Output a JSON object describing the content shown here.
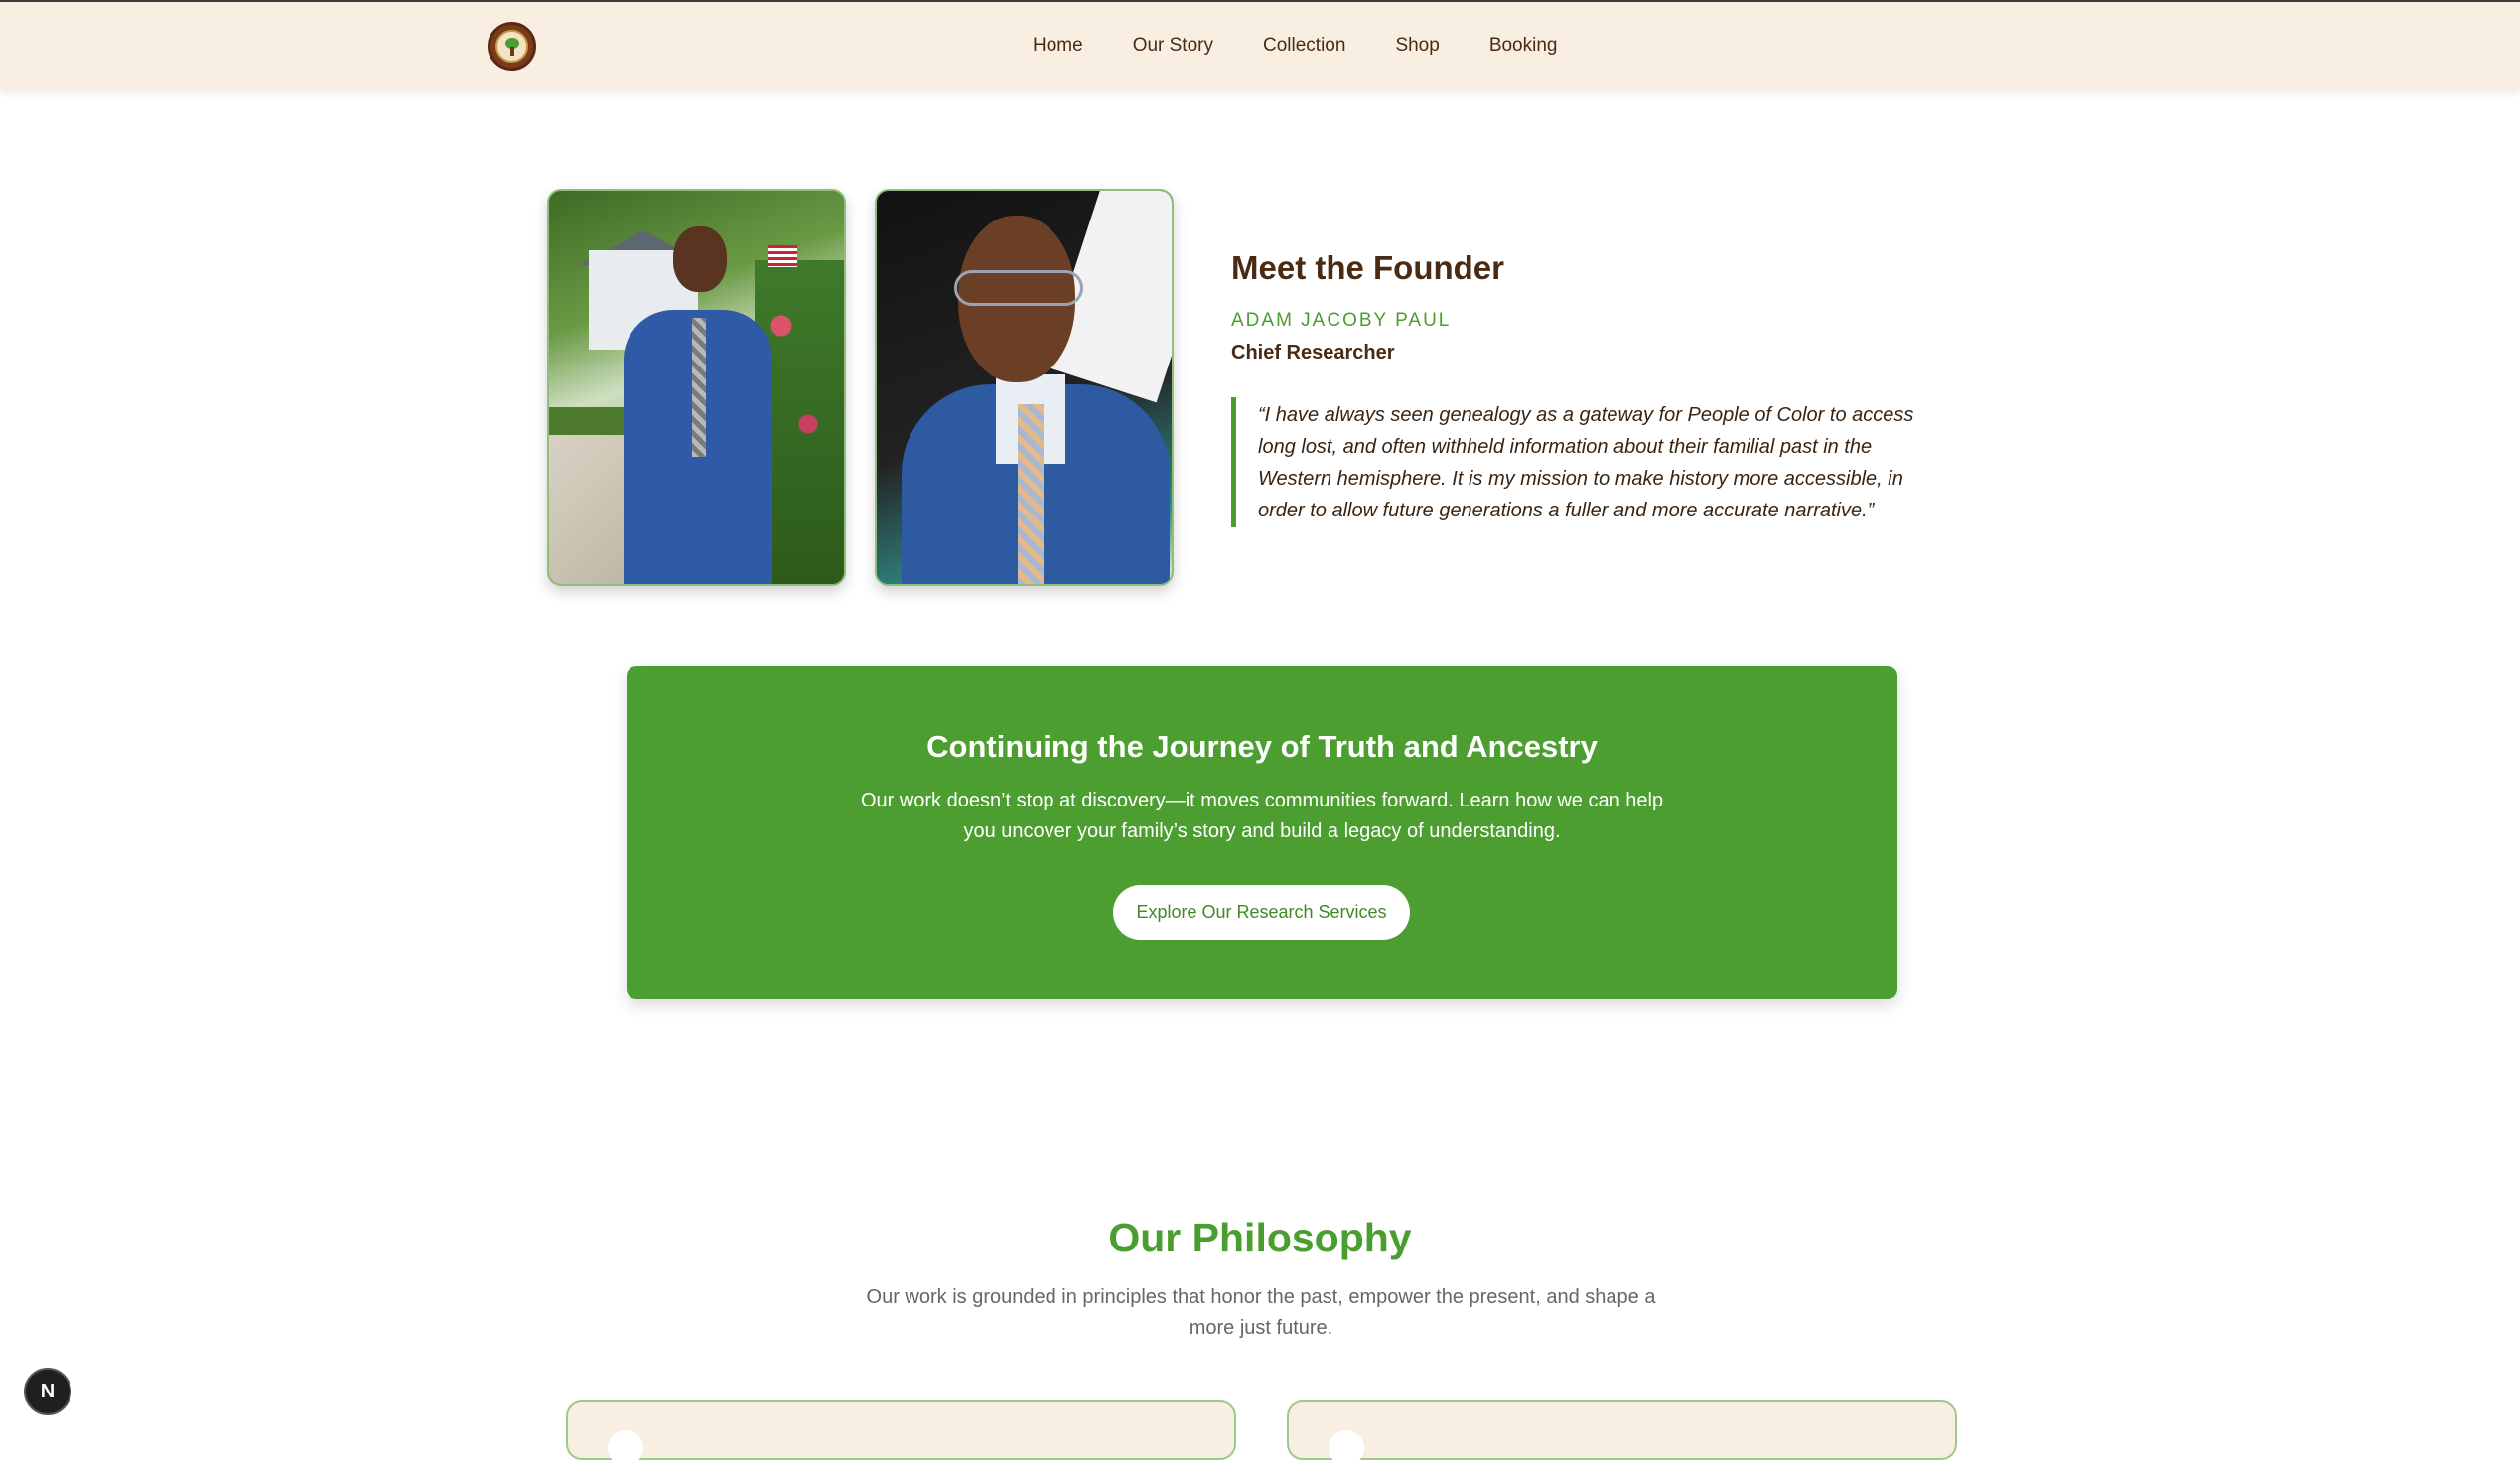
{
  "nav": {
    "links": [
      "Home",
      "Our Story",
      "Collection",
      "Shop",
      "Booking"
    ]
  },
  "founder": {
    "section_title": "Meet the Founder",
    "name": "ADAM JACOBY PAUL",
    "role": "Chief Researcher",
    "quote": "“I have always seen genealogy as a gateway for People of Color to access long lost, and often withheld information about their familial past in the Western hemisphere. It is my mission to make history more accessible, in order to allow future generations a fuller and more accurate narrative.”"
  },
  "banner": {
    "title": "Continuing the Journey of Truth and Ancestry",
    "text": "Our work doesn’t stop at discovery—it moves communities forward. Learn how we can help you uncover your family’s story and build a legacy of understanding.",
    "button_label": "Explore Our Research Services"
  },
  "philosophy": {
    "title": "Our Philosophy",
    "text": "Our work is grounded in principles that honor the past, empower the present, and shape a more just future."
  },
  "dev_badge": "N",
  "colors": {
    "brand_green": "#4b9e2f",
    "nav_bg": "#f8efe2",
    "text_brown": "#4a2a12"
  }
}
